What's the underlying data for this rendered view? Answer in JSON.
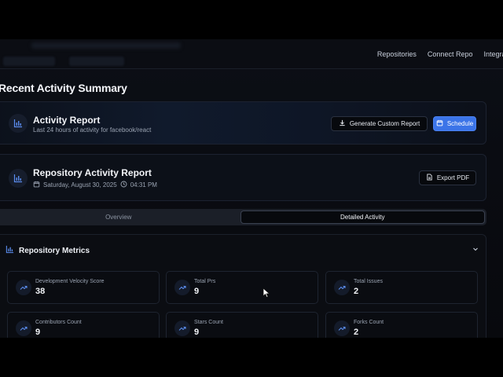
{
  "nav": {
    "links": [
      "Repositories",
      "Connect Repo",
      "Integrat"
    ]
  },
  "page": {
    "title": "Recent Activity Summary"
  },
  "activity_report": {
    "title": "Activity Report",
    "subtitle": "Last 24 hours of activity for facebook/react",
    "generate_label": "Generate Custom Report",
    "schedule_label": "Schedule"
  },
  "repo_report": {
    "title": "Repository Activity Report",
    "date": "Saturday, August 30, 2025",
    "time": "04:31 PM",
    "export_label": "Export PDF"
  },
  "tabs": [
    {
      "label": "Overview",
      "active": false
    },
    {
      "label": "Detailed Activity",
      "active": true
    }
  ],
  "metrics": {
    "title": "Repository Metrics",
    "items": [
      {
        "label": "Development Velocity Score",
        "value": "38"
      },
      {
        "label": "Total Prs",
        "value": "9"
      },
      {
        "label": "Total Issues",
        "value": "2"
      },
      {
        "label": "Contributors Count",
        "value": "9"
      },
      {
        "label": "Stars Count",
        "value": "9"
      },
      {
        "label": "Forks Count",
        "value": "2"
      }
    ]
  },
  "colors": {
    "accent": "#3b74e8",
    "icon_blue": "#5b8def",
    "background": "#0a0c12"
  },
  "icons": {
    "activity": "bar-chart-icon",
    "repo": "bar-chart-icon",
    "generate": "download-icon",
    "schedule": "calendar-icon",
    "export": "file-icon",
    "metrics": "bar-chart-icon",
    "metric": "trending-up-icon",
    "collapse": "chevron-down-icon"
  }
}
